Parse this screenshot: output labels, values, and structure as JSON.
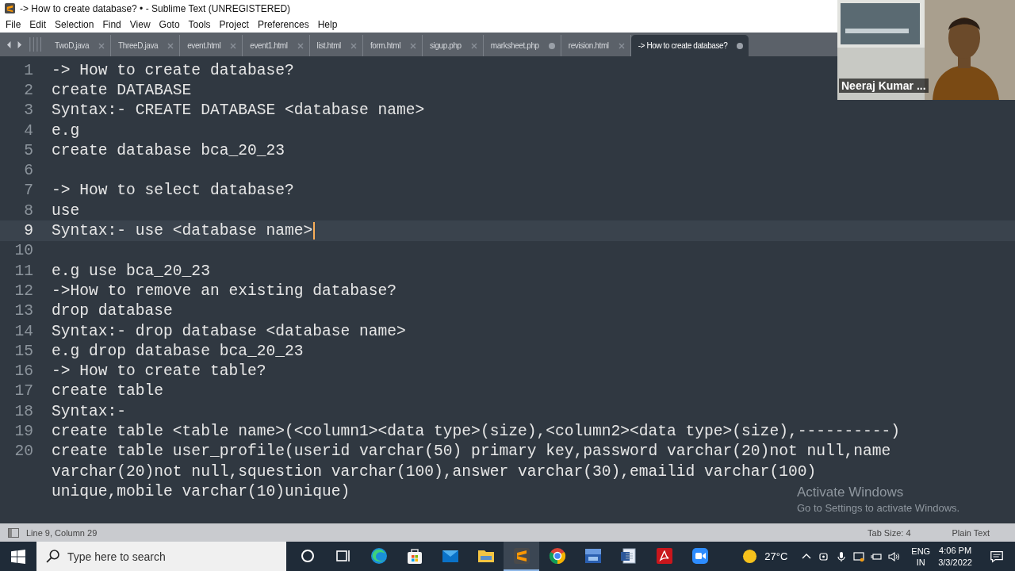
{
  "window": {
    "title": "-> How to create database? • - Sublime Text (UNREGISTERED)"
  },
  "menu": [
    "File",
    "Edit",
    "Selection",
    "Find",
    "View",
    "Goto",
    "Tools",
    "Project",
    "Preferences",
    "Help"
  ],
  "tabs": [
    {
      "label": "TwoD.java",
      "selected": false,
      "modified": false
    },
    {
      "label": "ThreeD.java",
      "selected": false,
      "modified": false
    },
    {
      "label": "event.html",
      "selected": false,
      "modified": false
    },
    {
      "label": "event1.html",
      "selected": false,
      "modified": false
    },
    {
      "label": "list.html",
      "selected": false,
      "modified": false
    },
    {
      "label": "form.html",
      "selected": false,
      "modified": false
    },
    {
      "label": "sigup.php",
      "selected": false,
      "modified": false
    },
    {
      "label": "marksheet.php",
      "selected": false,
      "modified": true
    },
    {
      "label": "revision.html",
      "selected": false,
      "modified": false
    },
    {
      "label": "-> How to create database?",
      "selected": true,
      "modified": true
    }
  ],
  "editor": {
    "lines": [
      {
        "number": "1",
        "text": "-> How to create database?",
        "current": false
      },
      {
        "number": "2",
        "text": "create DATABASE",
        "current": false
      },
      {
        "number": "3",
        "text": "Syntax:- CREATE DATABASE <database name>",
        "current": false
      },
      {
        "number": "4",
        "text": "e.g",
        "current": false
      },
      {
        "number": "5",
        "text": "create database bca_20_23",
        "current": false
      },
      {
        "number": "6",
        "current": false
      },
      {
        "number": "7",
        "text": "-> How to select database?",
        "current": false
      },
      {
        "number": "8",
        "text": "use",
        "current": false
      },
      {
        "number": "9",
        "text": "Syntax:- use <database name>",
        "current": true
      },
      {
        "number": "10",
        "current": false
      },
      {
        "number": "11",
        "text": "e.g use bca_20_23",
        "current": false
      },
      {
        "number": "12",
        "text": "->How to remove an existing database?",
        "current": false
      },
      {
        "number": "13",
        "text": "drop database",
        "current": false
      },
      {
        "number": "14",
        "text": "Syntax:- drop database <database name>",
        "current": false
      },
      {
        "number": "15",
        "text": "e.g drop database bca_20_23",
        "current": false
      },
      {
        "number": "16",
        "text": "-> How to create table?",
        "current": false
      },
      {
        "number": "17",
        "text": "create table",
        "current": false
      },
      {
        "number": "18",
        "text": "Syntax:-",
        "current": false
      },
      {
        "number": "19",
        "text": "create table <table name>(<column1><data type>(size),<column2><data type>(size),----------)",
        "current": false
      },
      {
        "number": "20",
        "text": "create table user_profile(userid varchar(50) primary key,password varchar(20)not null,name",
        "continued": [
          "varchar(20)not null,squestion varchar(100),answer varchar(30),emailid varchar(100)",
          "unique,mobile varchar(10)unique)"
        ],
        "current": false
      }
    ]
  },
  "activation": {
    "title": "Activate Windows",
    "hint": "Go to Settings to activate Windows."
  },
  "status_bar": {
    "position": "Line 9, Column 29",
    "tab_size": "Tab Size: 4",
    "syntax": "Plain Text"
  },
  "webcam": {
    "kind": "picture",
    "name": "Neeraj Kumar ..."
  },
  "taskbar": {
    "search_placeholder": "Type here to search",
    "apps": [
      {
        "kind": "cortana",
        "active": false
      },
      {
        "kind": "taskview",
        "active": false
      },
      {
        "kind": "edge",
        "active": false
      },
      {
        "kind": "store",
        "active": false
      },
      {
        "kind": "mail",
        "active": false
      },
      {
        "kind": "explorer",
        "active": false
      },
      {
        "kind": "sublime",
        "active": true
      },
      {
        "kind": "chrome",
        "active": false
      },
      {
        "kind": "devcpp",
        "active": false
      },
      {
        "kind": "word",
        "active": false
      },
      {
        "kind": "acrobat",
        "active": false
      },
      {
        "kind": "zoom",
        "active": false
      }
    ],
    "temperature": "27°C",
    "language": "ENG",
    "region": "IN",
    "time": "4:06 PM",
    "date": "3/3/2022"
  }
}
